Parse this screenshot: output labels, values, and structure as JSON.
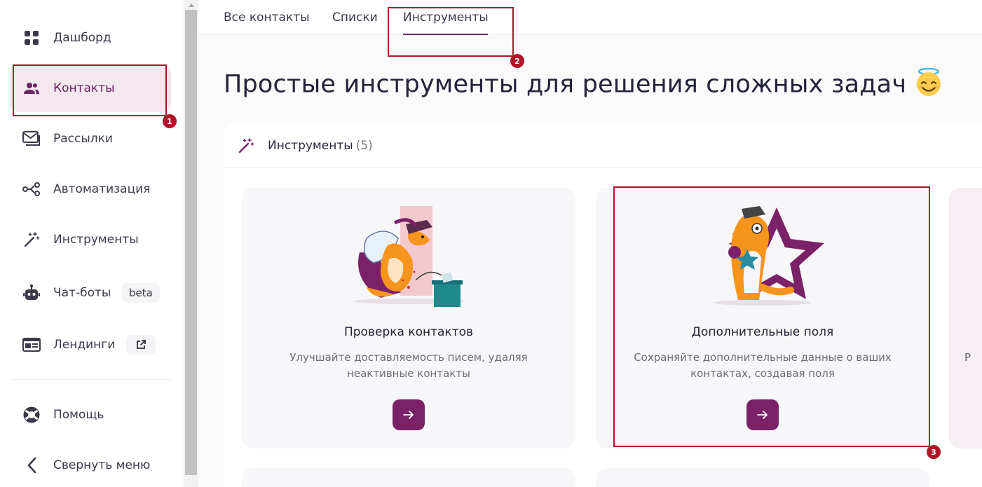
{
  "sidebar": {
    "items": [
      {
        "label": "Дашборд",
        "icon": "dashboard-icon"
      },
      {
        "label": "Контакты",
        "icon": "contacts-icon",
        "active": true
      },
      {
        "label": "Рассылки",
        "icon": "mail-icon"
      },
      {
        "label": "Автоматизация",
        "icon": "automation-icon"
      },
      {
        "label": "Инструменты",
        "icon": "magic-wand-icon"
      },
      {
        "label": "Чат-боты",
        "icon": "robot-icon",
        "badge": "beta"
      },
      {
        "label": "Лендинги",
        "icon": "landing-icon",
        "badge_icon": "external-link-icon"
      }
    ],
    "bottom": [
      {
        "label": "Помощь",
        "icon": "help-icon"
      },
      {
        "label": "Свернуть меню",
        "icon": "chevron-left-icon"
      }
    ]
  },
  "tabs": [
    {
      "label": "Все контакты"
    },
    {
      "label": "Списки"
    },
    {
      "label": "Инструменты",
      "active": true
    }
  ],
  "page": {
    "title": "Простые инструменты для решения сложных задач",
    "title_emoji": "smiling-face-with-halo-icon"
  },
  "panel": {
    "title": "Инструменты",
    "count": "(5)",
    "icon": "magic-wand-icon"
  },
  "cards": [
    {
      "title": "Проверка контактов",
      "description": "Улучшайте доставляемость писем, удаляя неактивные контакты",
      "button_icon": "arrow-right-icon",
      "illustration": "fox-sweeping-illustration"
    },
    {
      "title": "Дополнительные поля",
      "description": "Сохраняйте дополнительные данные о ваших контактах, создавая поля",
      "button_icon": "arrow-right-icon",
      "illustration": "fox-with-star-illustration"
    }
  ],
  "partial_card": {
    "text": "Р"
  },
  "annotations": [
    "1",
    "2",
    "3"
  ],
  "colors": {
    "accent": "#7b2167",
    "active_bg": "#f3e8ee",
    "annotation": "#b0152a",
    "fox_orange": "#f7941d"
  }
}
